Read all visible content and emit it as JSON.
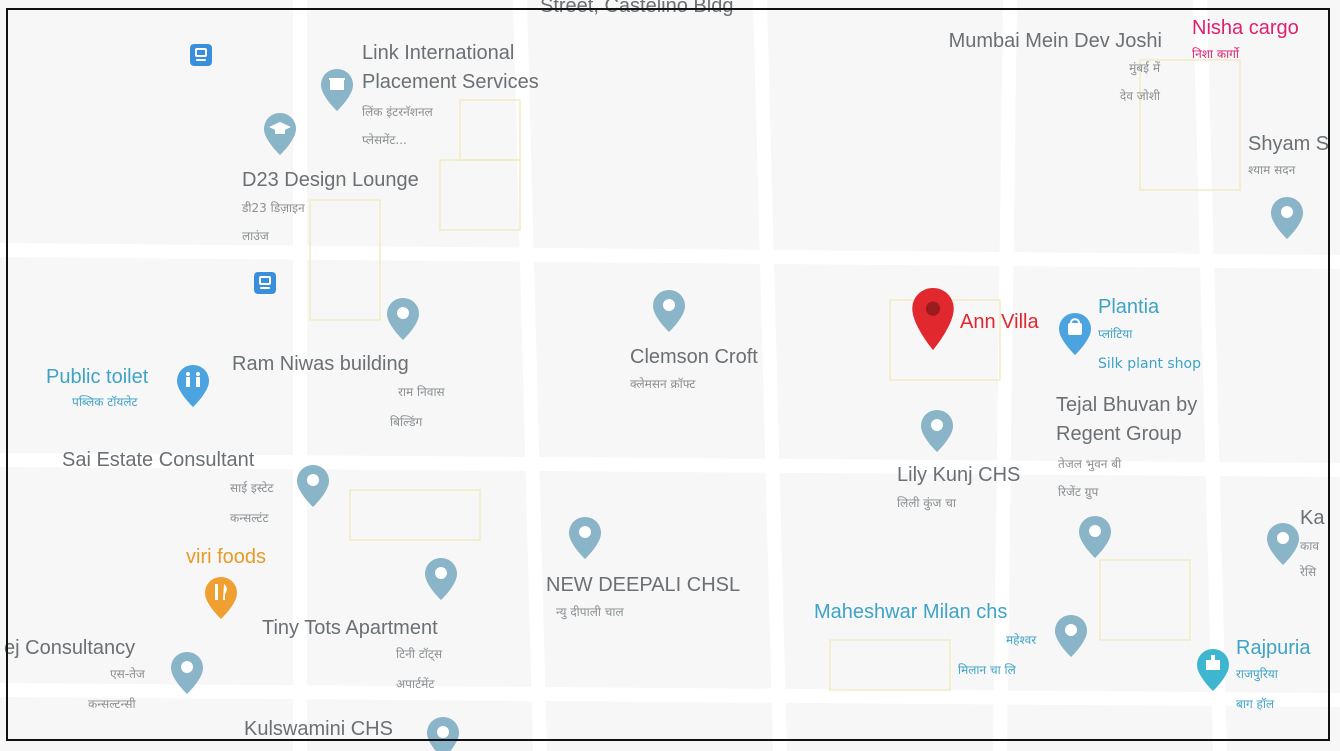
{
  "colors": {
    "background": "#f6f7f6",
    "road": "#ffffff",
    "building_outline": "#f3eec6",
    "poi_pin": "#8ab4c8",
    "selected_pin": "#e0282e",
    "transit": "#3a8fdc",
    "shop_label": "#3fa3c7",
    "food": "#e99a2a",
    "highlight_label": "#e01f6f"
  },
  "labels": {
    "top_street": "Street, Castelino Bldg",
    "link_international": {
      "en1": "Link International",
      "en2": "Placement Services",
      "hi1": "लिंक इंटरनॅशनल",
      "hi2": "प्लेसमेंट..."
    },
    "d23": {
      "en": "D23 Design Lounge",
      "hi1": "डी23 डिज़ाइन",
      "hi2": "लाउंज"
    },
    "mumbai_mein": {
      "en": "Mumbai Mein Dev Joshi",
      "hi1": "मुंबई में",
      "hi2": "देव जोशी"
    },
    "nisha": {
      "en": "Nisha cargo",
      "hi": "निशा कार्गो"
    },
    "shyam": {
      "en": "Shyam S",
      "hi": "श्याम सदन"
    },
    "ram_niwas": {
      "en": "Ram Niwas building",
      "hi1": "राम निवास",
      "hi2": "बिल्डिंग"
    },
    "public_toilet": {
      "en": "Public toilet",
      "hi": "पब्लिक टॉयलेट"
    },
    "clemson": {
      "en": "Clemson Croft",
      "hi": "क्लेमसन क्रॉफ्ट"
    },
    "ann_villa": {
      "en": "Ann Villa"
    },
    "plantia": {
      "en": "Plantia",
      "hi": "प्लांटिया",
      "sub": "Silk plant shop"
    },
    "tejal": {
      "en1": "Tejal Bhuvan by",
      "en2": "Regent Group",
      "hi1": "तेजल भुवन बी",
      "hi2": "रिजेंट ग्रुप"
    },
    "lily_kunj": {
      "en": "Lily Kunj CHS",
      "hi": "लिली कुंज चा"
    },
    "sai_estate": {
      "en": "Sai Estate Consultant",
      "hi1": "साई इस्टेट",
      "hi2": "कन्सल्टंट"
    },
    "viri_foods": {
      "en": "viri foods"
    },
    "new_deepali": {
      "en": "NEW DEEPALI CHSL",
      "hi": "न्यु दीपाली चाल"
    },
    "tiny_tots": {
      "en": "Tiny Tots Apartment",
      "hi1": "टिनी टॉट्स",
      "hi2": "अपार्टमेंट"
    },
    "tej_consultancy": {
      "en": "ej Consultancy",
      "hi1": "एस-तेज",
      "hi2": "कन्सल्टन्सी"
    },
    "maheshwar": {
      "en": "Maheshwar Milan chs",
      "hi1": "महेश्वर",
      "hi2": "मिलान चा लि"
    },
    "rajpuria": {
      "en": "Rajpuria",
      "hi1": "राजपुरिया",
      "hi2": "बाग हॉल"
    },
    "kulswamini": {
      "en": "Kulswamini CHS"
    },
    "ka": {
      "en": "Ka",
      "hi1": "काव",
      "hi2": "रेसि"
    }
  },
  "icons": {
    "bus": "bus-stop-icon",
    "poi": "location-pin-icon",
    "selected": "red-location-pin-icon",
    "government": "building-icon",
    "education": "graduation-cap-icon",
    "toilet": "restroom-icon",
    "shopping": "shopping-bag-icon",
    "food": "fork-knife-icon",
    "hall": "landmark-icon"
  }
}
